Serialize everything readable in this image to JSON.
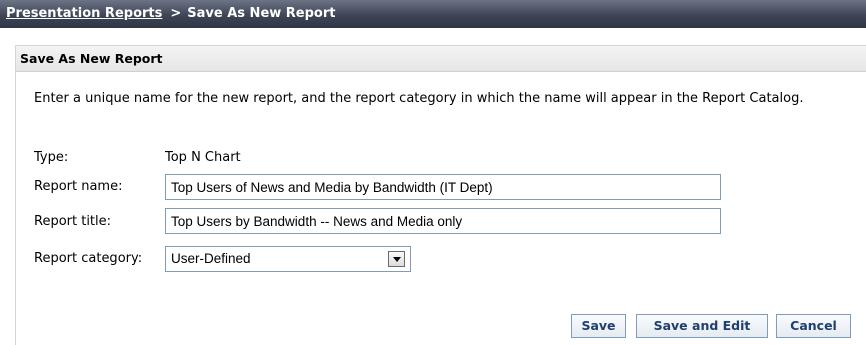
{
  "breadcrumb": {
    "parent": "Presentation Reports",
    "separator": ">",
    "current": "Save As New Report"
  },
  "panel": {
    "title": "Save As New Report",
    "intro": "Enter a unique name for the new report, and the report category in which the name will appear in the Report Catalog."
  },
  "form": {
    "type_label": "Type:",
    "type_value": "Top N Chart",
    "name_label": "Report name:",
    "name_value": "Top Users of News and Media by Bandwidth (IT Dept)",
    "title_label": "Report title:",
    "title_value": "Top Users by Bandwidth -- News and Media only",
    "category_label": "Report category:",
    "category_value": "User-Defined"
  },
  "buttons": {
    "save": "Save",
    "save_edit": "Save and Edit",
    "cancel": "Cancel"
  },
  "icons": {
    "dropdown": "chevron-down-icon"
  },
  "colors": {
    "title_bar": "#3e4656",
    "button_text": "#1f3f6f",
    "input_border": "#7f9db9"
  }
}
